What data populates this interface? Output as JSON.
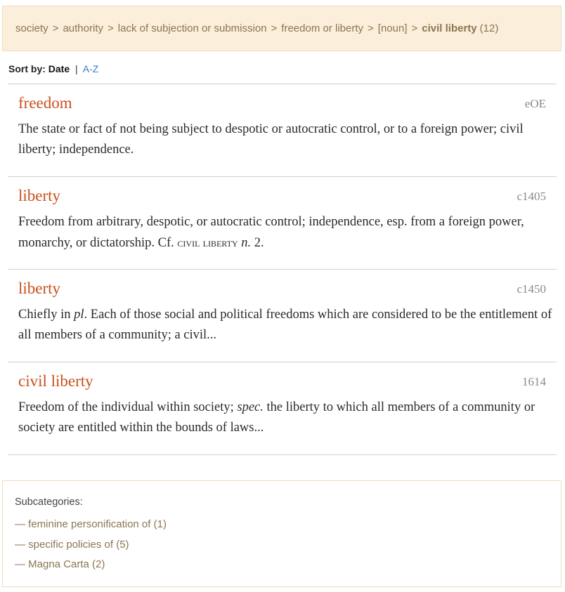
{
  "breadcrumb": {
    "items": [
      "society",
      "authority",
      "lack of subjection or submission",
      "freedom or liberty",
      "[noun]"
    ],
    "separator": ">",
    "current": "civil liberty",
    "count": "(12)"
  },
  "sort": {
    "label": "Sort by:",
    "active": "Date",
    "pipe": "|",
    "alternative": "A-Z"
  },
  "entries": [
    {
      "word": "freedom",
      "date": "eOE",
      "def_parts": [
        "The state or fact of not being subject to despotic or autocratic control, or to a foreign power; civil liberty; independence."
      ]
    },
    {
      "word": "liberty",
      "date": "c1405",
      "def_parts": [
        "Freedom from arbitrary, despotic, or autocratic control; independence, esp. from a foreign power, monarchy, or dictatorship. Cf. ",
        "civil liberty",
        " ",
        "n.",
        " 2."
      ]
    },
    {
      "word": "liberty",
      "date": "c1450",
      "def_parts": [
        "Chiefly in ",
        "pl",
        ". Each of those social and political freedoms which are considered to be the entitlement of all members of a community; a civil..."
      ]
    },
    {
      "word": "civil liberty",
      "date": "1614",
      "def_parts": [
        "Freedom of the individual within society; ",
        "spec.",
        " the liberty to which all members of a community or society are entitled within the bounds of laws..."
      ]
    }
  ],
  "subcategories": {
    "title": "Subcategories:",
    "items": [
      "— feminine personification of (1)",
      "— specific policies of (5)",
      "— Magna Carta (2)"
    ]
  }
}
